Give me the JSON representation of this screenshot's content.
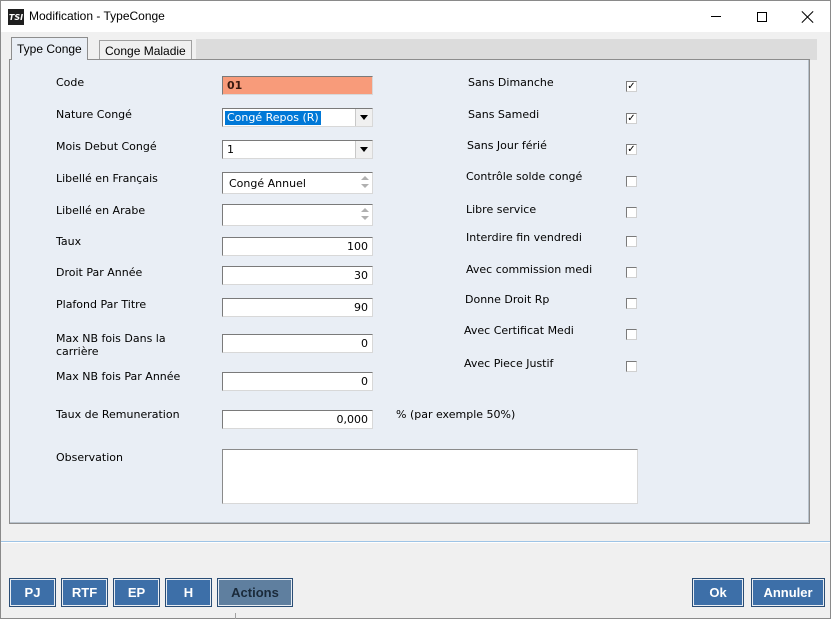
{
  "window": {
    "title": "Modification - TypeConge",
    "icon_text": "TSI"
  },
  "tabs": [
    {
      "label": "Type Conge",
      "active": true
    },
    {
      "label": "Conge Maladie",
      "active": false
    }
  ],
  "form": {
    "code": {
      "label": "Code",
      "value": "01"
    },
    "nature_conge": {
      "label": "Nature Congé",
      "value": "Congé Repos (R)"
    },
    "mois_debut": {
      "label": "Mois Debut Congé",
      "value": "1"
    },
    "libelle_fr": {
      "label": "Libellé en Français",
      "value": "Congé Annuel"
    },
    "libelle_ar": {
      "label": "Libellé en Arabe",
      "value": ""
    },
    "taux": {
      "label": "Taux",
      "value": "100"
    },
    "droit_annee": {
      "label": "Droit Par Année",
      "value": "30"
    },
    "plafond_titre": {
      "label": "Plafond Par Titre",
      "value": "90"
    },
    "max_carriere": {
      "label_line1": "Max NB fois Dans la",
      "label_line2": "carrière",
      "value": "0"
    },
    "max_annee": {
      "label": "Max NB fois Par Année",
      "value": "0"
    },
    "taux_remuneration": {
      "label": "Taux de Remuneration",
      "value": "0,000",
      "hint": "% (par exemple 50%)"
    },
    "observation": {
      "label": "Observation",
      "value": ""
    }
  },
  "checkboxes": [
    {
      "label": "Sans Dimanche",
      "checked": true
    },
    {
      "label": "Sans Samedi",
      "checked": true
    },
    {
      "label": "Sans Jour férié",
      "checked": true
    },
    {
      "label": "Contrôle solde congé",
      "checked": false
    },
    {
      "label": "Libre service",
      "checked": false
    },
    {
      "label": "Interdire fin vendredi",
      "checked": false
    },
    {
      "label": "Avec commission medi",
      "checked": false
    },
    {
      "label": "Donne Droit Rp",
      "checked": false
    },
    {
      "label": "Avec Certificat Medi",
      "checked": false
    },
    {
      "label": "Avec Piece Justif",
      "checked": false
    }
  ],
  "check_glyph": "✓",
  "buttons": {
    "pj": "PJ",
    "rtf": "RTF",
    "ep": "EP",
    "h": "H",
    "actions": "Actions",
    "ok": "Ok",
    "annuler": "Annuler"
  },
  "colors": {
    "accent_button": "#3d6fa8",
    "code_field": "#f89b7a",
    "selection": "#0078d7"
  }
}
